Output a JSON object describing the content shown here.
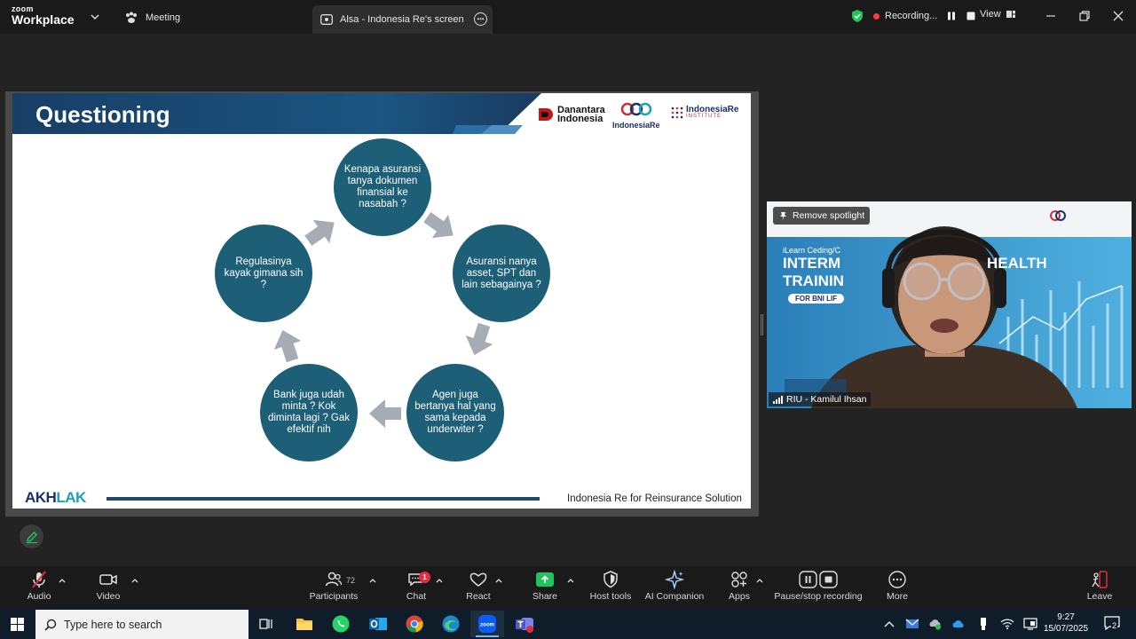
{
  "titlebar": {
    "brand_small": "zoom",
    "brand_big": "Workplace",
    "meeting_tab": "Meeting",
    "share_tab": "Alsa - Indonesia Re's screen",
    "recording_label": "Recording...",
    "view_label": "View"
  },
  "slide": {
    "title": "Questioning",
    "logo_danantara_line1": "Danantara",
    "logo_danantara_line2": "Indonesia",
    "logo_indonesiare": "IndonesiaRe",
    "logo_inst_line1": "IndonesiaRe",
    "logo_inst_line2": "INSTITUTE",
    "cycle": [
      "Kenapa asuransi tanya dokumen finansial ke nasabah ?",
      "Asuransi nanya asset, SPT dan lain sebagainya ?",
      "Agen juga bertanya hal yang sama kepada underwiter ?",
      "Bank juga udah minta ? Kok diminta lagi ? Gak efektif nih",
      "Regulasinya kayak gimana sih ?"
    ],
    "akhlak_part1": "AKH",
    "akhlak_part2": "LAK",
    "footer": "Indonesia Re for Reinsurance Solution"
  },
  "video": {
    "remove_spotlight": "Remove spotlight",
    "participant_name": "RIU - Kamilul Ihsan",
    "bg_line1": "iLearn Ceding/C",
    "bg_line2": "INTERM",
    "bg_line2b": "HEALTH",
    "bg_line3": "TRAININ",
    "bg_line4": "FOR BNI LIF"
  },
  "toolbar": {
    "audio": "Audio",
    "video": "Video",
    "participants": "Participants",
    "participants_count": "72",
    "chat": "Chat",
    "chat_badge": "1",
    "react": "React",
    "share": "Share",
    "host_tools": "Host tools",
    "ai_companion": "AI Companion",
    "apps": "Apps",
    "pause_stop": "Pause/stop recording",
    "more": "More",
    "leave": "Leave"
  },
  "taskbar": {
    "search_placeholder": "Type here to search",
    "time": "9:27",
    "date": "15/07/2025",
    "notification_count": "2"
  },
  "colors": {
    "slide_circle": "#1e5f78",
    "slide_header": "#173e66",
    "recording_dot": "#ff3b3b",
    "share_green": "#1fc45c",
    "badge_red": "#e02e3b"
  }
}
